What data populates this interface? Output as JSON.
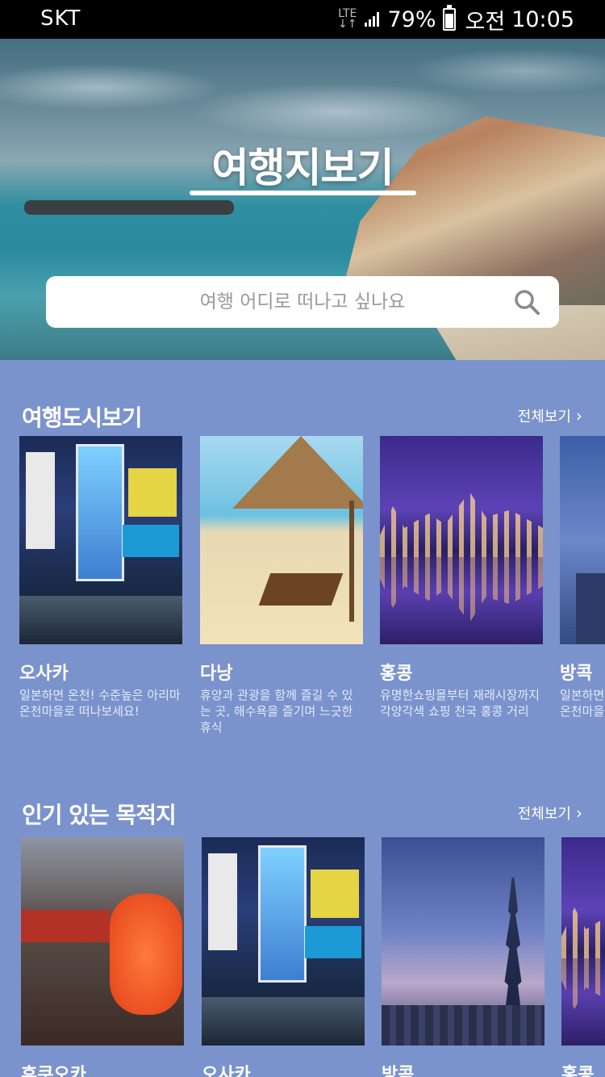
{
  "status_bar": {
    "carrier": "SKT",
    "network": "LTE",
    "battery": "79%",
    "ampm": "오전",
    "time": "10:05"
  },
  "hero": {
    "title": "여행지보기",
    "search_placeholder": "여행 어디로 떠나고 싶나요"
  },
  "sections": [
    {
      "title": "여행도시보기",
      "more_label": "전체보기",
      "cards": [
        {
          "name": "오사카",
          "description": "일본하면 온천! 수준높은 아리마 온천마을로 떠나보세요!"
        },
        {
          "name": "다낭",
          "description": "휴양과 관광을 함께 즐길 수 있는 곳, 해수욕을 즐기며 느긋한 휴식"
        },
        {
          "name": "홍콩",
          "description": "유명한쇼핑몰부터 재래시장까지 각양각색 쇼핑 천국 홍콩 거리"
        },
        {
          "name": "방콕",
          "description": "일본하면 온천! 수준높은 아리마 온천마을로 떠나보세요!"
        }
      ]
    },
    {
      "title": "인기 있는 목적지",
      "more_label": "전체보기",
      "cards": [
        {
          "name": "후쿠오카"
        },
        {
          "name": "오사카"
        },
        {
          "name": "방콕"
        },
        {
          "name": "홍콩"
        }
      ]
    }
  ],
  "colors": {
    "background": "#7b93cc",
    "status_bar": "#000000",
    "search_bg": "#ffffff"
  }
}
